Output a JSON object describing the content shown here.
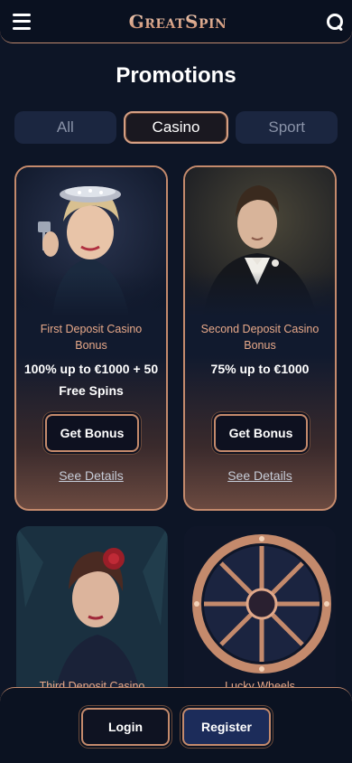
{
  "header": {
    "logo": "GreatSpin",
    "menu_icon": "hamburger-menu-icon",
    "search_icon": "search-icon"
  },
  "page": {
    "title": "Promotions"
  },
  "tabs": [
    {
      "label": "All",
      "active": false
    },
    {
      "label": "Casino",
      "active": true
    },
    {
      "label": "Sport",
      "active": false
    }
  ],
  "promotions": [
    {
      "subtitle": "First Deposit Casino Bonus",
      "offer": "100% up to €1000 + 50 Free Spins",
      "button": "Get Bonus",
      "details": "See Details"
    },
    {
      "subtitle": "Second Deposit Casino Bonus",
      "offer": "75% up to €1000",
      "button": "Get Bonus",
      "details": "See Details"
    },
    {
      "subtitle": "Third Deposit Casino"
    },
    {
      "subtitle": "Lucky Wheels"
    }
  ],
  "bottom_bar": {
    "login": "Login",
    "register": "Register"
  },
  "colors": {
    "accent": "#c48a6c",
    "promo_subtitle": "#e8a989",
    "background": "#0d1526"
  }
}
